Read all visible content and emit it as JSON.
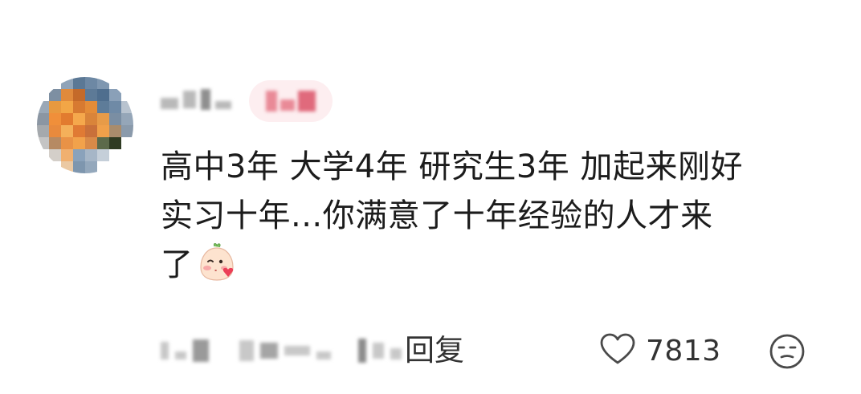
{
  "comment": {
    "author": {
      "avatar_icon": "avatar-pixelated-icon",
      "name_redacted": true,
      "badge_redacted": true
    },
    "text_line1": "高中3年 大学4年 研究生3年 加起来刚好",
    "text_line2": "实习十年...你满意了十年经验的人才来",
    "text_line3": "了",
    "emoji_icon": "blushing-blowing-kiss-icon",
    "meta_redacted": true,
    "reply_label": "回复",
    "like_icon": "heart-outline-icon",
    "like_count": "7813",
    "dislike_icon": "unimpressed-face-icon"
  },
  "colors": {
    "text": "#1c1c1c",
    "secondary": "#333333",
    "badge_bg": "#fdeef0",
    "badge_fg": "#e98a97",
    "redacted": "#c8c8c8"
  }
}
